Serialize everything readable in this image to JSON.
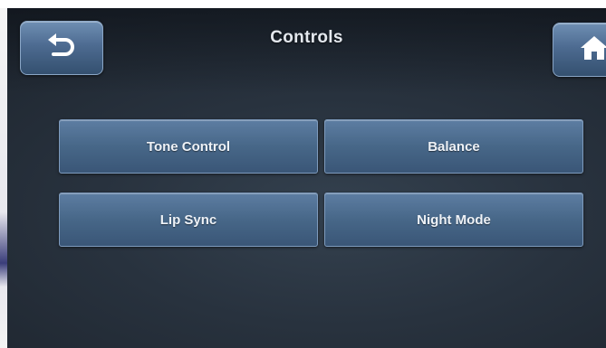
{
  "header": {
    "title": "Controls",
    "back_icon": "back-arrow-icon",
    "home_icon": "home-icon"
  },
  "menu": {
    "items": [
      {
        "label": "Tone Control"
      },
      {
        "label": "Balance"
      },
      {
        "label": "Lip Sync"
      },
      {
        "label": "Night Mode"
      }
    ]
  },
  "colors": {
    "background": "#28323e",
    "button": "#476788",
    "text": "#eef2f7"
  }
}
